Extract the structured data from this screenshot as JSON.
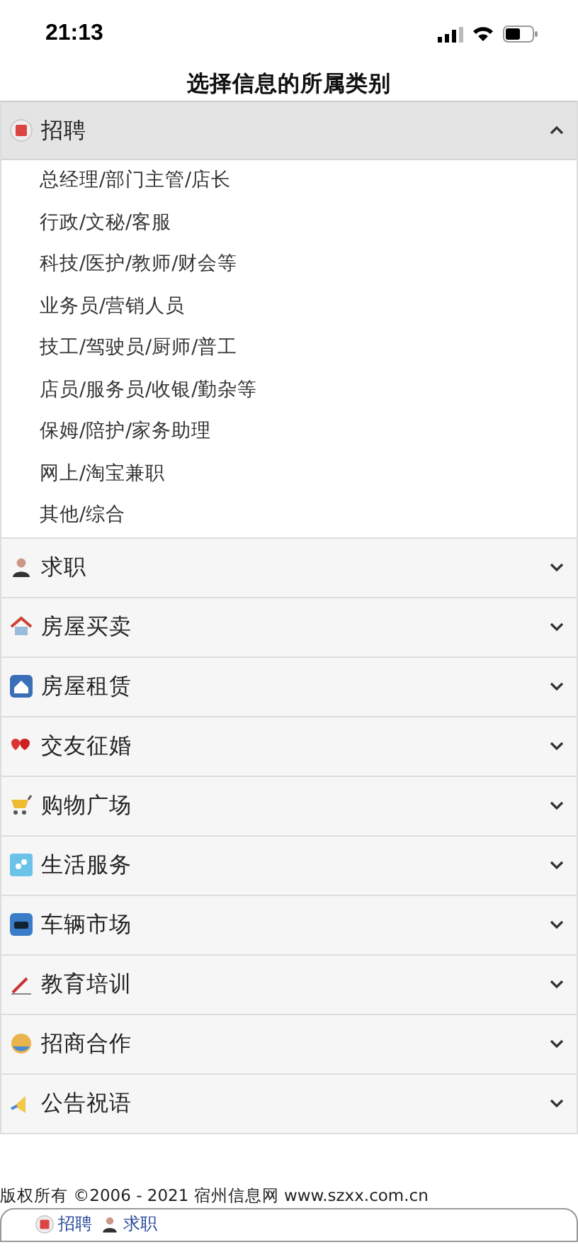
{
  "status_bar": {
    "time": "21:13"
  },
  "title": "选择信息的所属类别",
  "categories": [
    {
      "label": "招聘",
      "expanded": true,
      "items": [
        "总经理/部门主管/店长",
        "行政/文秘/客服",
        "科技/医护/教师/财会等",
        "业务员/营销人员",
        "技工/驾驶员/厨师/普工",
        "店员/服务员/收银/勤杂等",
        "保姆/陪护/家务助理",
        "网上/淘宝兼职",
        "其他/综合"
      ]
    },
    {
      "label": "求职",
      "expanded": false
    },
    {
      "label": "房屋买卖",
      "expanded": false
    },
    {
      "label": "房屋租赁",
      "expanded": false
    },
    {
      "label": "交友征婚",
      "expanded": false
    },
    {
      "label": "购物广场",
      "expanded": false
    },
    {
      "label": "生活服务",
      "expanded": false
    },
    {
      "label": "车辆市场",
      "expanded": false
    },
    {
      "label": "教育培训",
      "expanded": false
    },
    {
      "label": "招商合作",
      "expanded": false
    },
    {
      "label": "公告祝语",
      "expanded": false
    }
  ],
  "footer": {
    "copyright": "版权所有 ©2006 - 2021 宿州信息网 www.szxx.com.cn",
    "links": [
      "招聘",
      "求职"
    ]
  }
}
